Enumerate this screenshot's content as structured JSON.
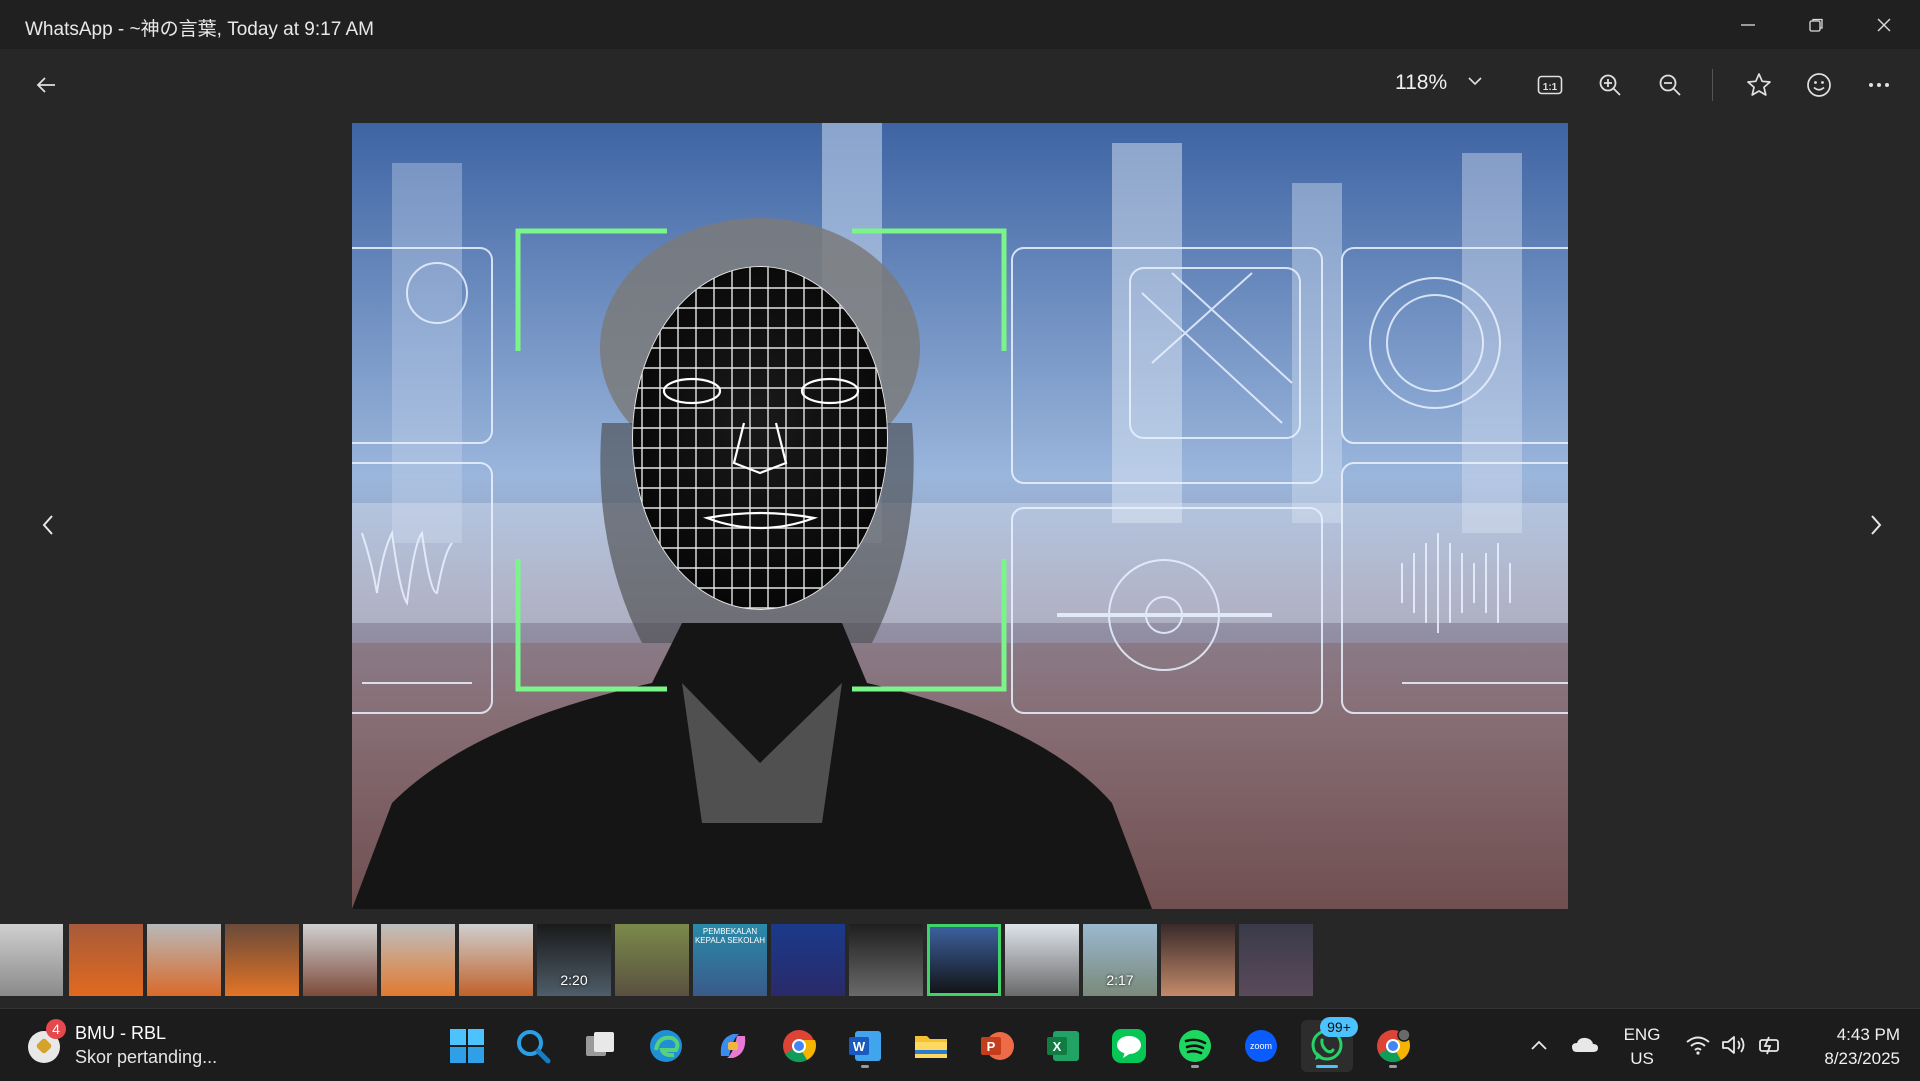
{
  "window": {
    "title": "WhatsApp - ~神の言葉, Today at 9:17 AM",
    "controls": [
      "minimize",
      "restore",
      "close"
    ]
  },
  "toolbar": {
    "zoom_level": "118%",
    "buttons": [
      "back-arrow-icon",
      "actual-size-icon",
      "zoom-in-icon",
      "zoom-out-icon",
      "star-icon",
      "emoji-icon",
      "more-icon"
    ]
  },
  "image": {
    "subject": "face-recognition-wireframe",
    "colors": {
      "frame": "#7bf58a",
      "hud": "#e8f2ff",
      "sky": "#4a6fa8"
    }
  },
  "filmstrip": {
    "durations": [
      "2:20",
      "2:17"
    ],
    "selected_index": 12,
    "selected_color": "#3fd36a",
    "thumb_label": "PEMBEKALAN KEPALA SEKOLAH"
  },
  "taskbar": {
    "notification": {
      "badge": "4",
      "title": "BMU - RBL",
      "text": "Skor pertanding..."
    },
    "apps": [
      "windows-start",
      "search",
      "task-view",
      "edge",
      "copilot",
      "chrome",
      "word",
      "file-explorer",
      "powerpoint",
      "excel",
      "line",
      "spotify",
      "zoom",
      "whatsapp",
      "chrome-profile"
    ],
    "whatsapp_badge": "99+",
    "zoom_label": "zoom",
    "accent": "#4cc2ff",
    "language": {
      "line1": "ENG",
      "line2": "US"
    },
    "time": "4:43 PM",
    "date": "8/23/2025"
  }
}
